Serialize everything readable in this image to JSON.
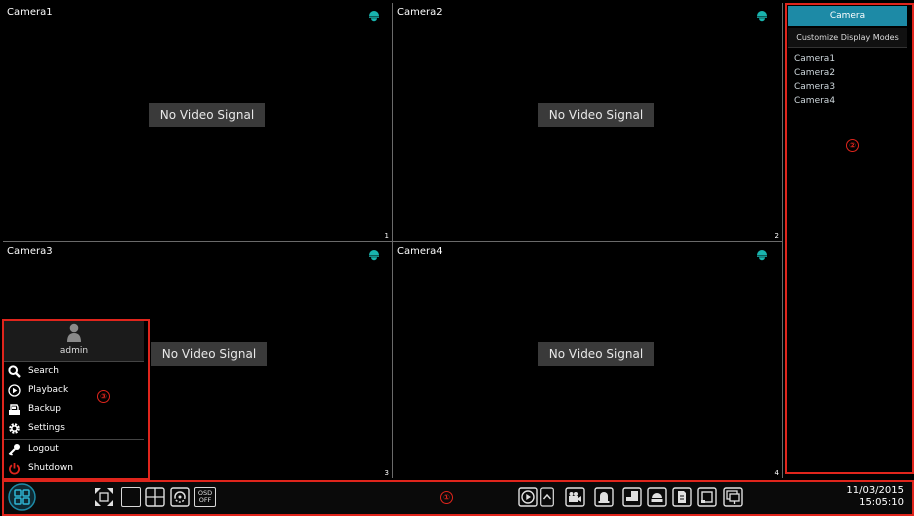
{
  "cameras": [
    {
      "title": "Camera1",
      "no_signal": "No Video Signal",
      "number": "1"
    },
    {
      "title": "Camera2",
      "no_signal": "No Video Signal",
      "number": "2"
    },
    {
      "title": "Camera3",
      "no_signal": "No Video Signal",
      "number": "3"
    },
    {
      "title": "Camera4",
      "no_signal": "No Video Signal",
      "number": "4"
    }
  ],
  "right_panel": {
    "tab": "Camera",
    "customize": "Customize Display Modes",
    "items": [
      "Camera1",
      "Camera2",
      "Camera3",
      "Camera4"
    ],
    "marker": "②"
  },
  "menu": {
    "user": "admin",
    "items": [
      {
        "label": "Search",
        "icon": "search-icon"
      },
      {
        "label": "Playback",
        "icon": "playback-icon"
      },
      {
        "label": "Backup",
        "icon": "backup-icon"
      },
      {
        "label": "Settings",
        "icon": "settings-icon"
      },
      {
        "label": "Logout",
        "icon": "logout-icon"
      },
      {
        "label": "Shutdown",
        "icon": "shutdown-icon"
      }
    ],
    "marker": "③"
  },
  "toolbar": {
    "marker": "①",
    "osd_top": "OSD",
    "osd_bottom": "OFF",
    "date": "11/03/2015",
    "time": "15:05:10"
  },
  "colors": {
    "accent": "#1d8aa6",
    "highlight": "#e0251c",
    "dome": "#19b4ae"
  }
}
